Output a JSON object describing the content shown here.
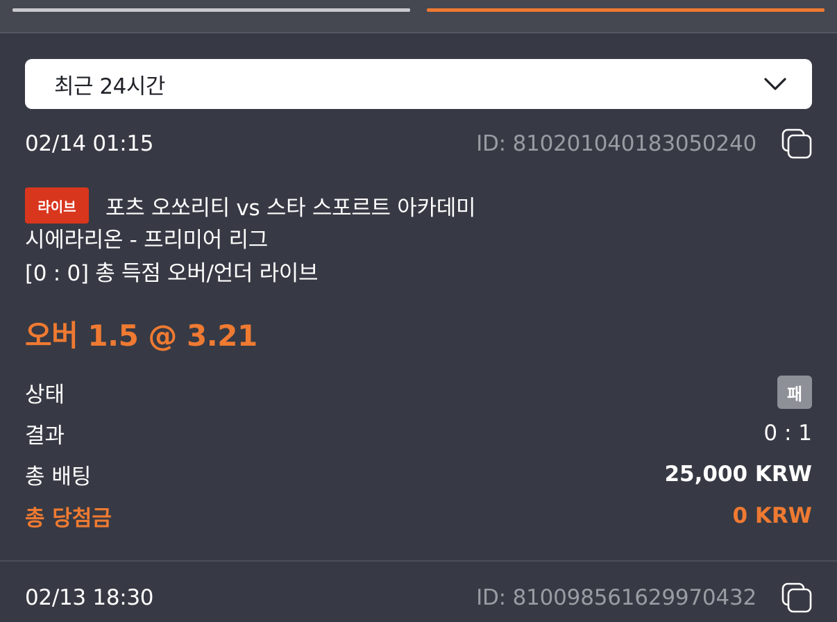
{
  "filter": {
    "label": "최근 24시간"
  },
  "bets": [
    {
      "date": "02/14 01:15",
      "id": "ID: 810201040183050240",
      "live_badge": "라이브",
      "match": "포츠 오쏘리티 vs 스타 스포르트 아카데미",
      "league": "시에라리온 - 프리미어 리그",
      "market": "[0 : 0] 총 득점 오버/언더 라이브",
      "selection": "오버 1.5 @ 3.21",
      "status_label": "상태",
      "status_value": "패",
      "result_label": "결과",
      "result_value": "0 : 1",
      "stake_label": "총 배팅",
      "stake_value": "25,000 KRW",
      "payout_label": "총 당첨금",
      "payout_value": "0 KRW"
    },
    {
      "date": "02/13 18:30",
      "id": "ID: 810098561629970432"
    }
  ],
  "colors": {
    "accent": "#ef7a32",
    "live_badge": "#d9361e",
    "status_badge": "#8e9097",
    "background": "#373a44"
  },
  "icons": [
    "chevron-down-icon",
    "copy-icon"
  ]
}
